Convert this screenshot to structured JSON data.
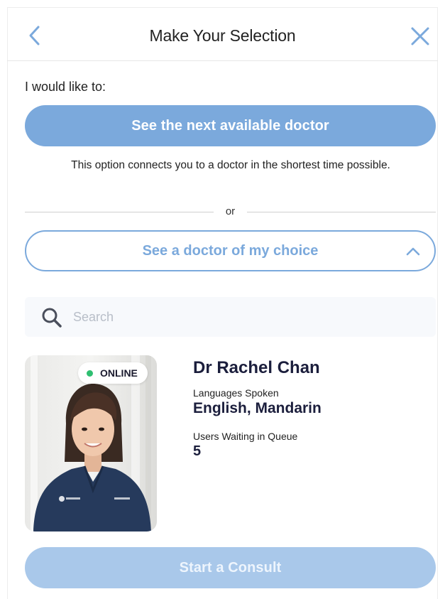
{
  "header": {
    "title": "Make Your Selection",
    "back_icon": "chevron-left-icon",
    "close_icon": "close-icon"
  },
  "intro": "I would like to:",
  "next_doctor": {
    "label": "See the next available doctor",
    "helper": "This option connects you to a doctor in the shortest time possible."
  },
  "divider": "or",
  "choice": {
    "label": "See a doctor of my choice",
    "icon": "chevron-up-icon"
  },
  "search": {
    "placeholder": "Search",
    "value": "",
    "icon": "search-icon"
  },
  "doctor": {
    "status": "ONLINE",
    "name": "Dr Rachel Chan",
    "languages_label": "Languages Spoken",
    "languages": "English, Mandarin",
    "queue_label": "Users Waiting in Queue",
    "queue": "5"
  },
  "consult_button": "Start a Consult",
  "colors": {
    "accent": "#7ba9dc",
    "disabled": "#a9c8ea",
    "online": "#2fbf71",
    "heading": "#1b1e3c"
  }
}
